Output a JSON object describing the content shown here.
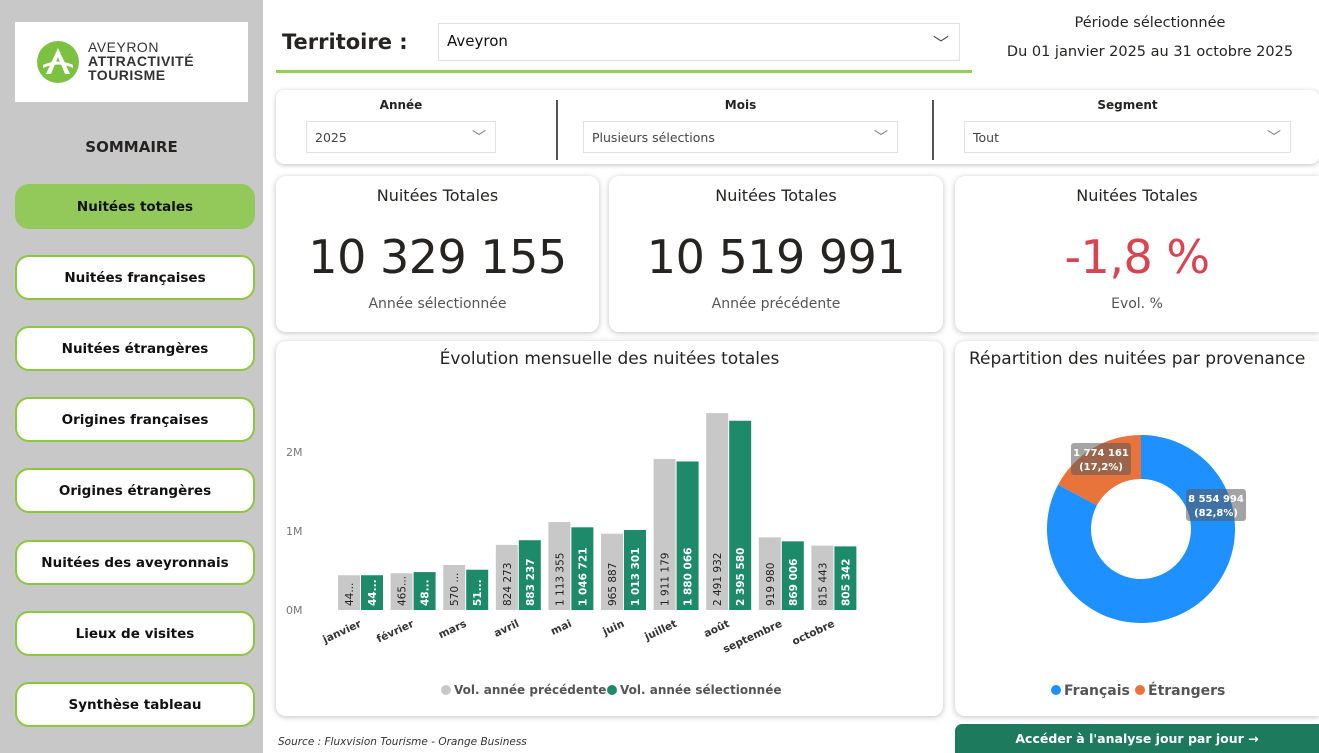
{
  "logo": {
    "line1": "AVEYRON",
    "line2": "ATTRACTIVITÉ",
    "line3": "TOURISME"
  },
  "sidebar": {
    "title": "SOMMAIRE",
    "items": [
      {
        "label": "Nuitées totales",
        "active": true
      },
      {
        "label": "Nuitées françaises",
        "active": false
      },
      {
        "label": "Nuitées étrangères",
        "active": false
      },
      {
        "label": "Origines françaises",
        "active": false
      },
      {
        "label": "Origines étrangères",
        "active": false
      },
      {
        "label": "Nuitées des aveyronnais",
        "active": false
      },
      {
        "label": "Lieux de visites",
        "active": false
      },
      {
        "label": "Synthèse tableau",
        "active": false
      }
    ]
  },
  "header": {
    "territoire_label": "Territoire :",
    "territoire_value": "Aveyron",
    "periode_title": "Période sélectionnée",
    "periode_range": "Du 01 janvier 2025 au 31 octobre 2025"
  },
  "filters": {
    "annee_label": "Année",
    "annee_value": "2025",
    "mois_label": "Mois",
    "mois_value": "Plusieurs sélections",
    "segment_label": "Segment",
    "segment_value": "Tout"
  },
  "kpis": [
    {
      "title": "Nuitées Totales",
      "value": "10 329 155",
      "sub": "Année sélectionnée"
    },
    {
      "title": "Nuitées Totales",
      "value": "10 519 991",
      "sub": "Année précédente"
    },
    {
      "title": "Nuitées Totales",
      "value": "-1,8 %",
      "sub": "Evol. %"
    }
  ],
  "colors": {
    "accent_green": "#92d050",
    "prev_year": "#c8c8c8",
    "sel_year": "#1d8a6a",
    "francais": "#1e90ff",
    "etrangers": "#e8743b",
    "negative": "#d64550"
  },
  "chart_data": [
    {
      "type": "bar",
      "title": "Évolution mensuelle des nuitées totales",
      "categories": [
        "janvier",
        "février",
        "mars",
        "avril",
        "mai",
        "juin",
        "juillet",
        "août",
        "septembre",
        "octobre"
      ],
      "series": [
        {
          "name": "Vol. année précédente",
          "values": [
            440000,
            465000,
            570000,
            824273,
            1113355,
            965887,
            1911179,
            2491932,
            919980,
            815443
          ],
          "labels": [
            "44...",
            "465...",
            "570 ...",
            "824 273",
            "1 113 355",
            "965 887",
            "1 911 179",
            "2 491 932",
            "919 980",
            "815 443"
          ]
        },
        {
          "name": "Vol. année sélectionnée",
          "values": [
            440000,
            480000,
            510000,
            883237,
            1046721,
            1013301,
            1880066,
            2395580,
            869006,
            805342
          ],
          "labels": [
            "44...",
            "48...",
            "51...",
            "883 237",
            "1 046 721",
            "1 013 301",
            "1 880 066",
            "2 395 580",
            "869 006",
            "805 342"
          ]
        }
      ],
      "ytick_labels": [
        "0M",
        "1M",
        "2M"
      ],
      "ytick_values": [
        0,
        1000000,
        2000000
      ],
      "ylim": [
        0,
        2500000
      ],
      "grid": false,
      "legend_position": "bottom"
    },
    {
      "type": "pie",
      "title": "Répartition des nuitées par provenance",
      "slices": [
        {
          "name": "Français",
          "value": 8554994,
          "label": "8 554 994",
          "pct": "(82,8%)"
        },
        {
          "name": "Étrangers",
          "value": 1774161,
          "label": "1 774 161",
          "pct": "(17,2%)"
        }
      ],
      "legend_position": "bottom"
    }
  ],
  "footer": {
    "source": "Source : Fluxvision Tourisme - Orange Business",
    "cta": "Accéder à l'analyse jour par jour →"
  }
}
